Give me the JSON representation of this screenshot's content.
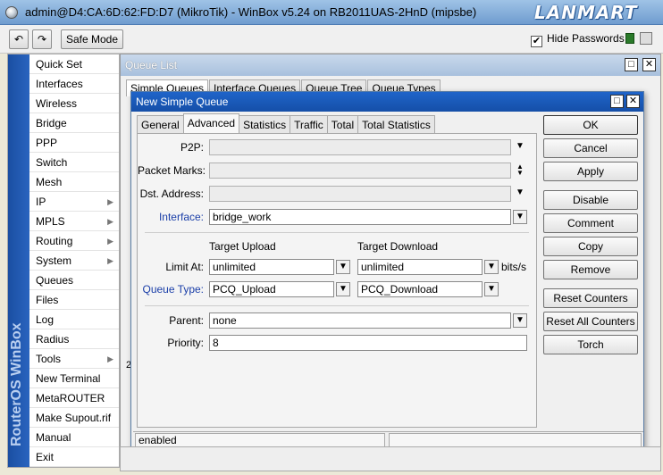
{
  "window": {
    "title": "admin@D4:CA:6D:62:FD:D7 (MikroTik) - WinBox v5.24 on RB2011UAS-2HnD (mipsbe)",
    "brand": "LANMART"
  },
  "toolbar": {
    "undo_icon": "undo-arrow",
    "redo_icon": "redo-arrow",
    "safe_mode": "Safe Mode",
    "hide_passwords_label": "Hide Passwords",
    "hide_passwords_checked": "✔"
  },
  "sidebar": {
    "vertical_brand": "RouterOS WinBox",
    "items": [
      {
        "label": "Quick Set",
        "sub": ""
      },
      {
        "label": "Interfaces",
        "sub": ""
      },
      {
        "label": "Wireless",
        "sub": ""
      },
      {
        "label": "Bridge",
        "sub": ""
      },
      {
        "label": "PPP",
        "sub": ""
      },
      {
        "label": "Switch",
        "sub": ""
      },
      {
        "label": "Mesh",
        "sub": ""
      },
      {
        "label": "IP",
        "sub": "▶"
      },
      {
        "label": "MPLS",
        "sub": "▶"
      },
      {
        "label": "Routing",
        "sub": "▶"
      },
      {
        "label": "System",
        "sub": "▶"
      },
      {
        "label": "Queues",
        "sub": ""
      },
      {
        "label": "Files",
        "sub": ""
      },
      {
        "label": "Log",
        "sub": ""
      },
      {
        "label": "Radius",
        "sub": ""
      },
      {
        "label": "Tools",
        "sub": "▶"
      },
      {
        "label": "New Terminal",
        "sub": ""
      },
      {
        "label": "MetaROUTER",
        "sub": ""
      },
      {
        "label": "Make Supout.rif",
        "sub": ""
      },
      {
        "label": "Manual",
        "sub": ""
      },
      {
        "label": "Exit",
        "sub": ""
      }
    ]
  },
  "queue_list": {
    "title": "Queue List",
    "tabs": [
      "Simple Queues",
      "Interface Queues",
      "Queue Tree",
      "Queue Types"
    ],
    "status_char": "2"
  },
  "dialog": {
    "title": "New Simple Queue",
    "tabs": [
      "General",
      "Advanced",
      "Statistics",
      "Traffic",
      "Total",
      "Total Statistics"
    ],
    "active_tab": "Advanced",
    "fields": {
      "p2p_label": "P2P:",
      "p2p_value": "",
      "packet_marks_label": "Packet Marks:",
      "packet_marks_value": "",
      "dst_address_label": "Dst. Address:",
      "dst_address_value": "",
      "interface_label": "Interface:",
      "interface_value": "bridge_work",
      "target_upload_header": "Target Upload",
      "target_download_header": "Target Download",
      "limit_at_label": "Limit At:",
      "limit_at_upload": "unlimited",
      "limit_at_download": "unlimited",
      "limit_unit": "bits/s",
      "queue_type_label": "Queue Type:",
      "queue_type_upload": "PCQ_Upload",
      "queue_type_download": "PCQ_Download",
      "parent_label": "Parent:",
      "parent_value": "none",
      "priority_label": "Priority:",
      "priority_value": "8"
    },
    "buttons": [
      "OK",
      "Cancel",
      "Apply",
      "Disable",
      "Comment",
      "Copy",
      "Remove",
      "Reset Counters",
      "Reset All Counters",
      "Torch"
    ],
    "status": "enabled"
  },
  "colors": {
    "accent_blue": "#1a3ea8",
    "title_blue": "#1f64c9"
  }
}
